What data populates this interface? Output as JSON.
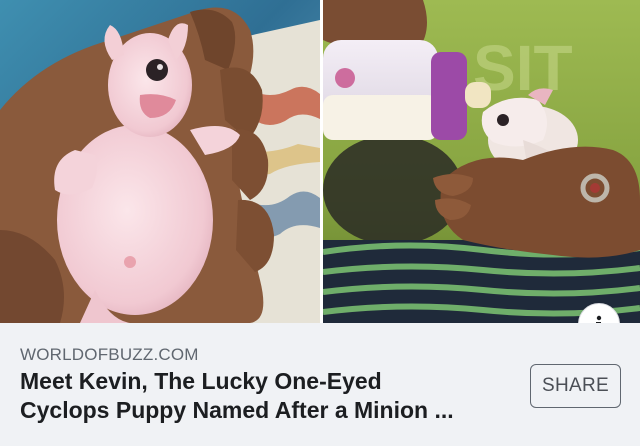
{
  "link_preview": {
    "domain": "WORLDOFBUZZ.COM",
    "headline_line1": "Meet Kevin, The Lucky One-Eyed",
    "headline_line2": "Cyclops Puppy Named After a Minion ...",
    "share_label": "SHARE",
    "info_icon": "info-icon",
    "info_glyph": "i"
  },
  "images": [
    {
      "name": "photo-puppy-held-in-hand",
      "alt": ""
    },
    {
      "name": "photo-puppy-bottle-fed",
      "alt": ""
    }
  ],
  "colors": {
    "footer_bg": "#f0f2f5",
    "domain_text": "#606770",
    "headline_text": "#1c1e21",
    "share_border": "#606770"
  }
}
